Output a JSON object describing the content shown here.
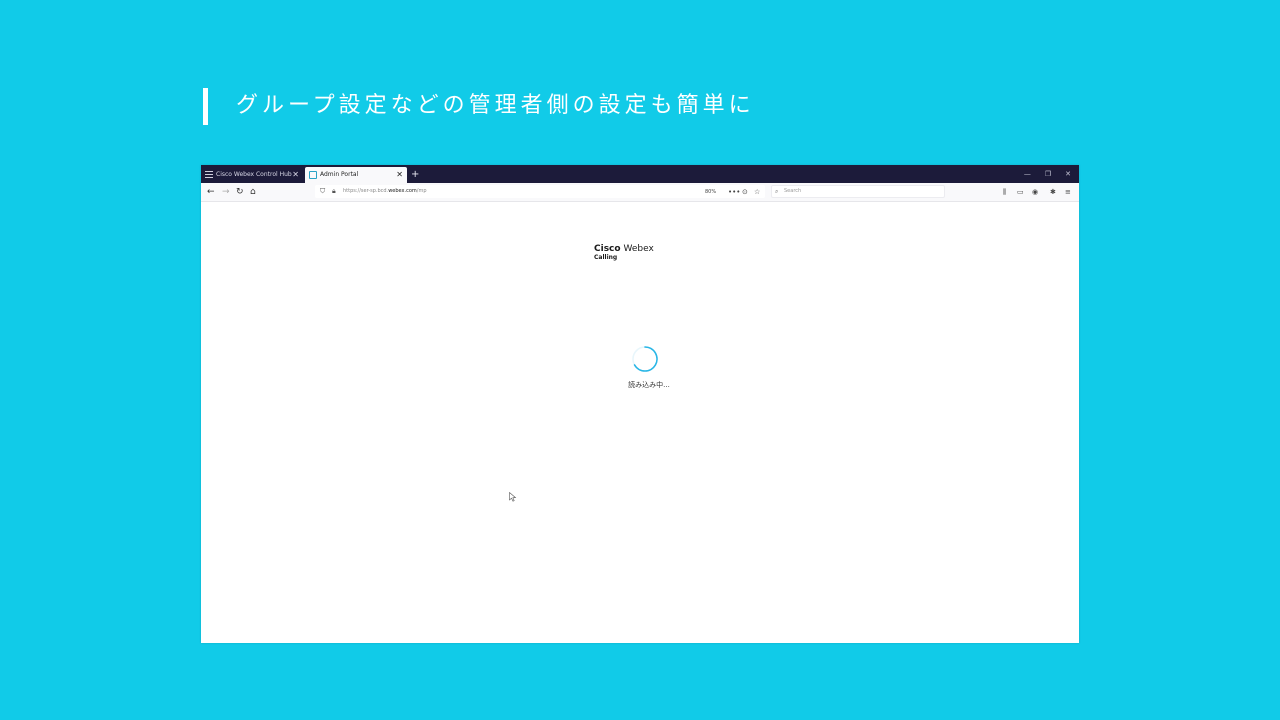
{
  "slide": {
    "heading": "グループ設定などの管理者側の設定も簡単に",
    "background_color": "#11cbe8",
    "accent_color": "#ffffff"
  },
  "browser": {
    "tabs": [
      {
        "label": "Cisco Webex Control Hub",
        "icon": "menu-icon",
        "active": false
      },
      {
        "label": "Admin Portal",
        "icon": "portal-icon",
        "active": true
      }
    ],
    "new_tab_label": "+",
    "url": {
      "prefix": "https://ser-sp.bcd.",
      "domain": "webex.com",
      "suffix": "/mp"
    },
    "zoom": "80%",
    "search_placeholder": "Search"
  },
  "page": {
    "logo_brand": "Cisco",
    "logo_product": "Webex",
    "logo_subtitle": "Calling",
    "loading_text": "読み込み中...",
    "spinner_color": "#29b6e6"
  }
}
